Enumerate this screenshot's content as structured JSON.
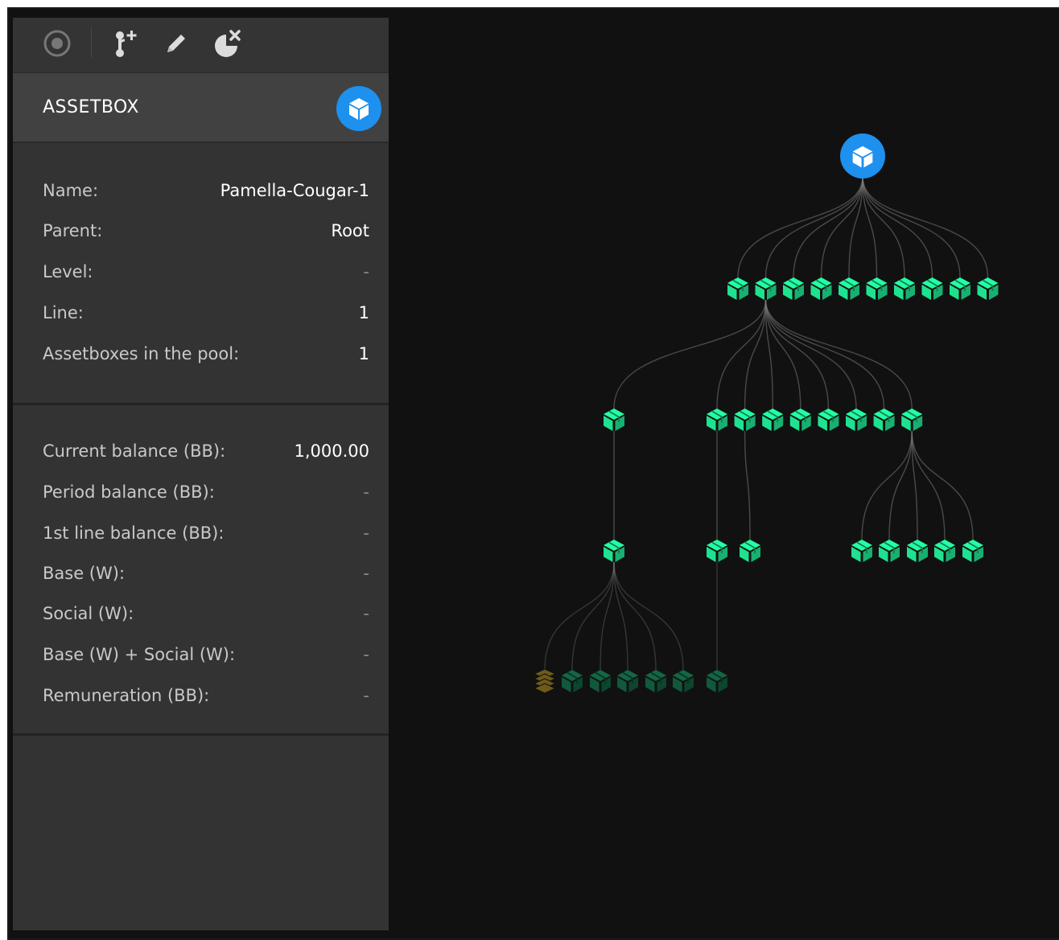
{
  "toolbar": {
    "buttons": [
      {
        "name": "target",
        "icon": "target-icon"
      },
      {
        "name": "add-branch",
        "icon": "branch-add-icon"
      },
      {
        "name": "edit",
        "icon": "pencil-icon"
      },
      {
        "name": "remove",
        "icon": "pie-remove-icon"
      }
    ]
  },
  "header": {
    "title": "ASSETBOX",
    "badge_icon": "cube-icon",
    "badge_color": "#1e90ee"
  },
  "info": {
    "name_label": "Name:",
    "name_value": "Pamella-Cougar-1",
    "parent_label": "Parent:",
    "parent_value": "Root",
    "level_label": "Level:",
    "level_value": "-",
    "line_label": "Line:",
    "line_value": "1",
    "pool_label": "Assetboxes in the pool:",
    "pool_value": "1"
  },
  "balance": {
    "current_label": "Current balance (BB):",
    "current_value": "1,000.00",
    "period_label": "Period balance (BB):",
    "period_value": "-",
    "first_line_label": "1st line balance (BB):",
    "first_line_value": "-",
    "base_label": "Base (W):",
    "base_value": "-",
    "social_label": "Social (W):",
    "social_value": "-",
    "base_social_label": "Base (W) + Social (W):",
    "base_social_value": "-",
    "remuneration_label": "Remuneration (BB):",
    "remuneration_value": "-"
  },
  "colors": {
    "node_active": "#1ee28f",
    "node_dim": "#11593c",
    "node_pool": "#6d5a1a",
    "root": "#1e90ee",
    "edge": "#7a7a7a"
  },
  "tree": {
    "root": {
      "icon": "cube-icon"
    },
    "levels": [
      {
        "count": 10,
        "state": "active"
      },
      {
        "count": 9,
        "state": "active"
      },
      {
        "count": 8,
        "state": "active"
      },
      {
        "count": 7,
        "state": "dim",
        "pool_count": 1
      }
    ]
  }
}
